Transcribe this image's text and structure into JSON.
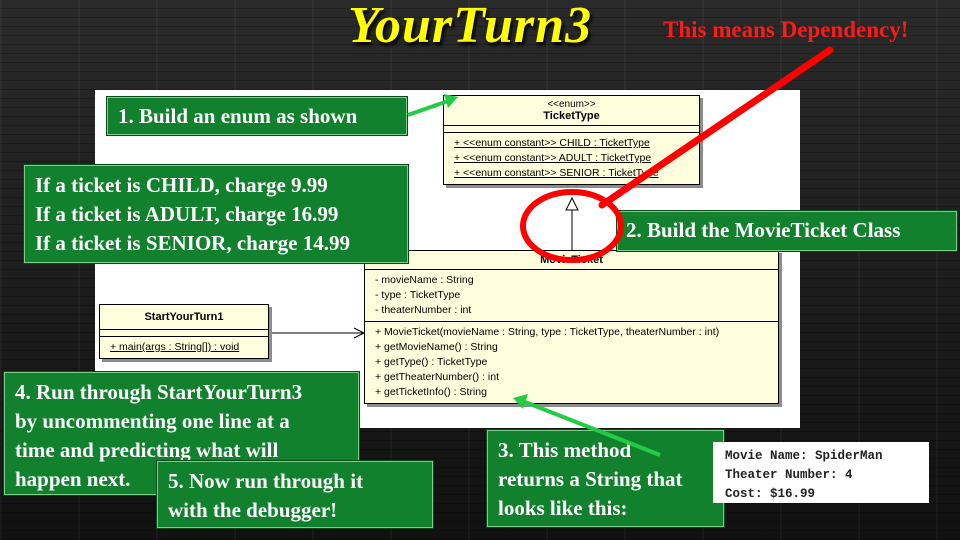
{
  "slide": {
    "title": "YourTurn3",
    "dependency_note": "This means Dependency!"
  },
  "uml": {
    "ticket_type": {
      "stereotype": "<<enum>>",
      "name": "TicketType",
      "constants": [
        "+ <<enum constant>> CHILD : TicketType",
        "+ <<enum constant>> ADULT : TicketType",
        "+ <<enum constant>> SENIOR : TicketType"
      ]
    },
    "movie_ticket": {
      "name": "MovieTicket",
      "attributes": [
        "- movieName : String",
        "- type : TicketType",
        "- theaterNumber : int"
      ],
      "operations": [
        "+ MovieTicket(movieName : String, type : TicketType, theaterNumber : int)",
        "+ getMovieName() : String",
        "+ getType() : TicketType",
        "+ getTheaterNumber() : int",
        "+ getTicketInfo() : String"
      ]
    },
    "start_your_turn": {
      "name": "StartYourTurn1",
      "operations": [
        "+ main(args : String[]) : void"
      ]
    }
  },
  "callouts": {
    "step1": "1.  Build an enum as shown",
    "pricing": [
      "If a ticket is CHILD, charge 9.99",
      "If a ticket is ADULT,  charge 16.99",
      "If a ticket is SENIOR, charge 14.99"
    ],
    "step2": "2.  Build the MovieTicket Class",
    "step3": [
      "3. This method",
      "returns a String that",
      "looks like this:"
    ],
    "step4": [
      "4.  Run through StartYourTurn3",
      "by uncommenting  one line at a",
      "time and predicting what will",
      "happen next."
    ],
    "step5": [
      "5.  Now run through it",
      "with the debugger!"
    ]
  },
  "sample_output": [
    "Movie Name: SpiderMan",
    "Theater Number: 4",
    "Cost: $16.99"
  ],
  "colors": {
    "title": "#ffff00",
    "dependency_note": "#ff1a1a",
    "callout_bg": "#11812e",
    "uml_fill": "#ffffde",
    "annotation_line": "#ff0000",
    "pointer_arrow": "#22cc44"
  }
}
